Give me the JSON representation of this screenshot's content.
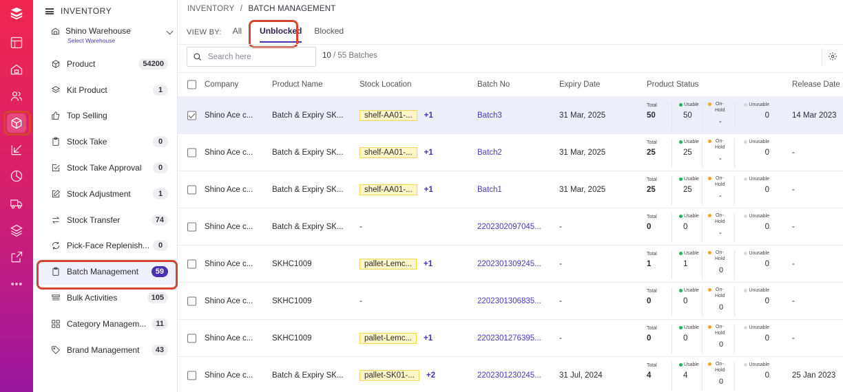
{
  "rail": {
    "icons": [
      "logo-icon",
      "layout-icon",
      "home-icon",
      "users-icon",
      "box-icon",
      "inbound-icon",
      "chart-icon",
      "truck-icon",
      "layers-icon",
      "external-link-icon",
      "more-icon"
    ]
  },
  "sidebar": {
    "header": "INVENTORY",
    "warehouse": {
      "name": "Shino Warehouse",
      "sub": "Select Warehouse"
    },
    "items": [
      {
        "label": "Product",
        "badge": "54200",
        "icon": "cube-icon"
      },
      {
        "label": "Kit Product",
        "badge": "1",
        "icon": "stack-icon"
      },
      {
        "label": "Top Selling",
        "badge": "",
        "icon": "thumbs-up-icon"
      },
      {
        "label": "Stock Take",
        "badge": "0",
        "icon": "clipboard-icon"
      },
      {
        "label": "Stock Take Approval",
        "badge": "0",
        "icon": "check-square-icon"
      },
      {
        "label": "Stock Adjustment",
        "badge": "1",
        "icon": "edit-icon"
      },
      {
        "label": "Stock Transfer",
        "badge": "74",
        "icon": "transfer-icon"
      },
      {
        "label": "Pick-Face Replenish...",
        "badge": "0",
        "icon": "refresh-icon"
      },
      {
        "label": "Batch Management",
        "badge": "59",
        "icon": "clipboard-icon",
        "active": true
      },
      {
        "label": "Bulk Activities",
        "badge": "105",
        "icon": "bulk-icon"
      },
      {
        "label": "Category Managem...",
        "badge": "11",
        "icon": "grid-icon"
      },
      {
        "label": "Brand Management",
        "badge": "43",
        "icon": "tag-icon"
      }
    ]
  },
  "breadcrumb": {
    "root": "INVENTORY",
    "separator": "/",
    "current": "BATCH MANAGEMENT"
  },
  "viewby": {
    "label": "VIEW BY:",
    "tabs": [
      {
        "label": "All"
      },
      {
        "label": "Unblocked",
        "selected": true
      },
      {
        "label": "Blocked"
      }
    ]
  },
  "search": {
    "placeholder": "Search here",
    "value": ""
  },
  "count": {
    "shown": "10",
    "separator": " / ",
    "total": "55 Batches"
  },
  "table": {
    "headers": [
      "Company",
      "Product Name",
      "Stock Location",
      "Batch No",
      "Expiry Date",
      "Product Status",
      "Release Date"
    ],
    "status_labels": {
      "total": "Total",
      "usable": "Usable",
      "hold_line1": "On-",
      "hold_line2": "Hold",
      "unusable": "Unusable"
    },
    "rows": [
      {
        "company": "Shino Ace c...",
        "product": "Batch & Expiry SK...",
        "location": "shelf-AA01-...",
        "extra": "+1",
        "batch": "Batch3",
        "expiry": "31 Mar, 2025",
        "total": "50",
        "usable": "50",
        "hold": "-",
        "unusable": "0",
        "release": "14 Mar 2023",
        "selected": true
      },
      {
        "company": "Shino Ace c...",
        "product": "Batch & Expiry SK...",
        "location": "shelf-AA01-...",
        "extra": "+1",
        "batch": "Batch2",
        "expiry": "31 Mar, 2025",
        "total": "25",
        "usable": "25",
        "hold": "-",
        "unusable": "0",
        "release": "-"
      },
      {
        "company": "Shino Ace c...",
        "product": "Batch & Expiry SK...",
        "location": "shelf-AA01-...",
        "extra": "+1",
        "batch": "Batch1",
        "expiry": "31 Mar, 2025",
        "total": "25",
        "usable": "25",
        "hold": "-",
        "unusable": "0",
        "release": "-"
      },
      {
        "company": "Shino Ace c...",
        "product": "Batch & Expiry SK...",
        "location": "-",
        "extra": "",
        "batch": "2202302097045...",
        "expiry": "-",
        "total": "0",
        "usable": "0",
        "hold": "-",
        "unusable": "0",
        "release": "-"
      },
      {
        "company": "Shino Ace c...",
        "product": "SKHC1009",
        "location": "pallet-Lemc...",
        "extra": "+1",
        "batch": "2202301309245...",
        "expiry": "-",
        "total": "1",
        "usable": "1",
        "hold": "0",
        "unusable": "0",
        "release": "-"
      },
      {
        "company": "Shino Ace c...",
        "product": "SKHC1009",
        "location": "-",
        "extra": "",
        "batch": "2202301306835...",
        "expiry": "-",
        "total": "0",
        "usable": "0",
        "hold": "0",
        "unusable": "0",
        "release": "-"
      },
      {
        "company": "Shino Ace c...",
        "product": "SKHC1009",
        "location": "pallet-Lemc...",
        "extra": "+1",
        "batch": "2202301276395...",
        "expiry": "-",
        "total": "0",
        "usable": "0",
        "hold": "0",
        "unusable": "0",
        "release": "-"
      },
      {
        "company": "Shino Ace c...",
        "product": "Batch & Expiry SK...",
        "location": "pallet-SK01-...",
        "extra": "+2",
        "batch": "2202301230245...",
        "expiry": "31 Jul, 2024",
        "total": "4",
        "usable": "4",
        "hold": "0",
        "unusable": "0",
        "release": "25 Jan 2023"
      }
    ]
  },
  "colors": {
    "accent": "#4a2fb0",
    "usable": "#1fb35a",
    "hold": "#f5a623",
    "unusable": "#d8d8de",
    "highlight": "#d3452f"
  }
}
